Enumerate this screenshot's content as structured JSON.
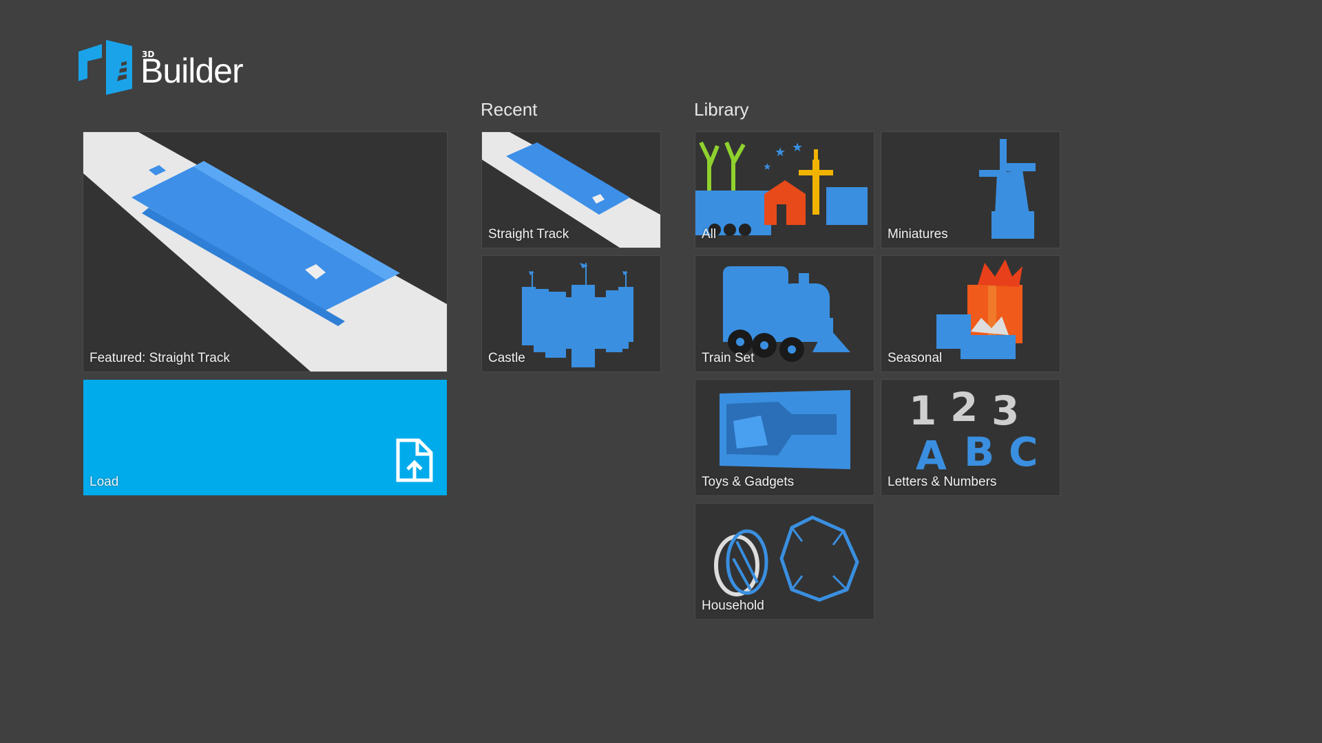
{
  "app": {
    "logo_super": "3D",
    "logo_name": "Builder"
  },
  "featured": {
    "label": "Featured: Straight Track"
  },
  "load": {
    "label": "Load"
  },
  "recent": {
    "title": "Recent",
    "items": [
      {
        "label": "Straight Track"
      },
      {
        "label": "Castle"
      }
    ]
  },
  "library": {
    "title": "Library",
    "items": [
      {
        "label": "All"
      },
      {
        "label": "Miniatures"
      },
      {
        "label": "Train Set"
      },
      {
        "label": "Seasonal"
      },
      {
        "label": "Toys & Gadgets"
      },
      {
        "label": "Letters & Numbers"
      },
      {
        "label": "Household"
      }
    ]
  },
  "colors": {
    "background": "#404040",
    "tile": "#333333",
    "accent": "#00abec",
    "model_blue": "#3a8fe0"
  },
  "icons": {
    "logo": "3d-builder-logo-icon",
    "load": "file-upload-icon"
  }
}
